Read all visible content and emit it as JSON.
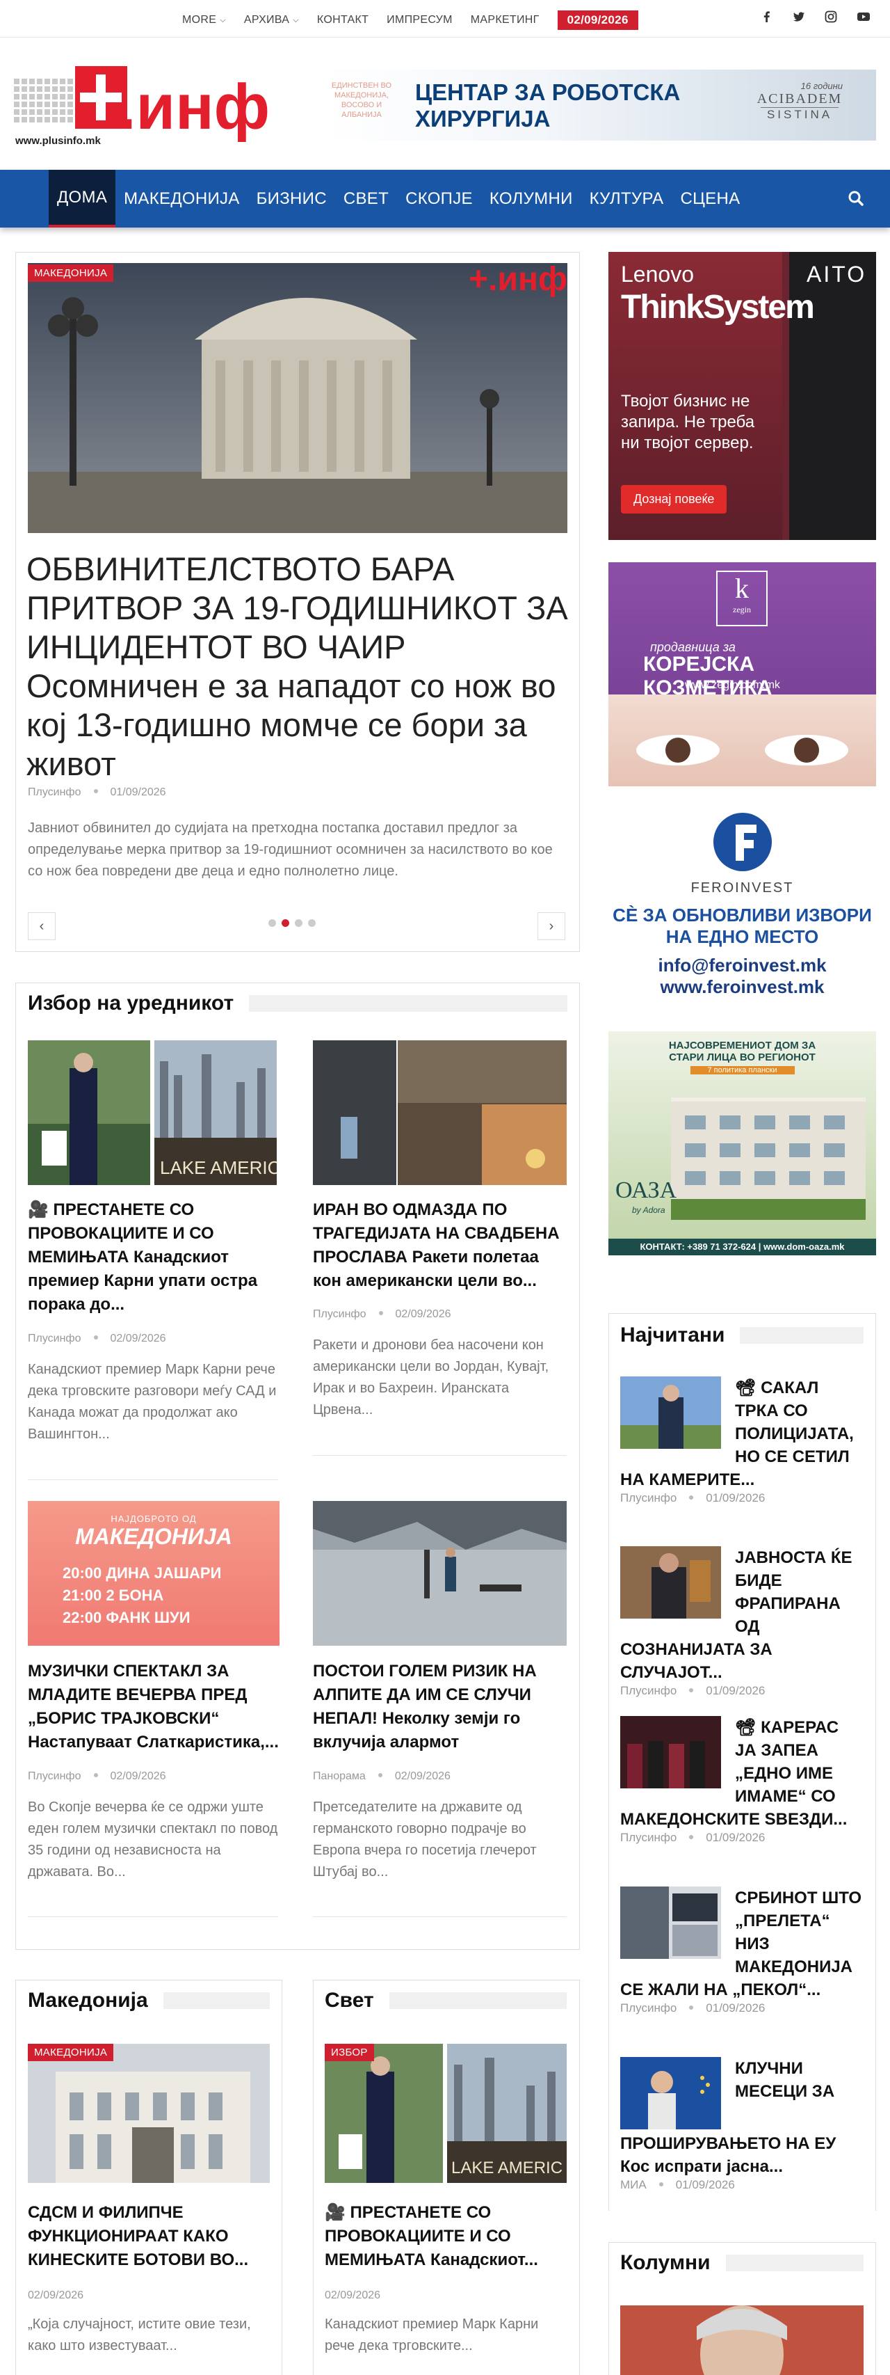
{
  "topbar": {
    "menu": [
      "MORE",
      "АРХИВА",
      "КОНТАКТ",
      "ИМПРЕСУМ",
      "МАРКЕТИНГ"
    ],
    "date": "02/09/2026"
  },
  "logo": {
    "text": "+.инф",
    "url": "www.plusinfo.mk"
  },
  "ad_top": {
    "small": "ЕДИНСТВЕН ВО МАКЕДОНИЈА, ВОСОВО И АЛБАНИЈА",
    "line1": "ЦЕНТАР ЗА РОБОТСКА",
    "line2": "ХИРУРГИЈА",
    "years": "16 години",
    "brand": "ACIBADEM",
    "brand2": "SISTINA"
  },
  "nav": {
    "items": [
      "ДОМА",
      "МАКЕДОНИЈА",
      "БИЗНИС",
      "СВЕТ",
      "СКОПЈЕ",
      "КОЛУМНИ",
      "КУЛТУРА",
      "СЦЕНА"
    ]
  },
  "featured": {
    "badge": "МАКЕДОНИЈА",
    "title": "ОБВИНИТЕЛСТВОТО БАРА ПРИТВОР ЗА 19-ГОДИШНИКОТ ЗА ИНЦИДЕНТОТ ВО ЧАИР Осомничен е за нападот со нож во кој 13-годишно момче се бори за живот",
    "author": "Плусинфо",
    "date": "01/09/2026",
    "excerpt": "Јавниот обвинител до судијата на претходна постапка доставил предлог за определување мерка притвор за 19-годишниот осомничен за насилството во кое со нож беа повредени две деца и едно полнолетно лице.",
    "prev": "‹",
    "next": "›"
  },
  "editor": {
    "title": "Избор на уредникот",
    "posts": [
      {
        "title": "🎥 ПРЕСТАНЕТЕ СО ПРОВОКАЦИИТЕ И СО МЕМИЊАТА Канадскиот премиер Карни упати остра порака до...",
        "author": "Плусинфо",
        "date": "02/09/2026",
        "excerpt": "Канадскиот премиер Марк Карни рече дека трговските разговори меѓу САД и Канада можат да продолжат ако Вашингтон..."
      },
      {
        "title": "ИРАН ВО ОДМАЗДА ПО ТРАГЕДИЈАТА НА СВАДБЕНА ПРОСЛАВА Ракети полетаа кон американски цели во...",
        "author": "Плусинфо",
        "date": "02/09/2026",
        "excerpt": "Ракети и дронови беа насочени кон американски цели во Јордан, Кувајт, Ирак и во Бахреин. Иранската Црвена..."
      },
      {
        "title": "МУЗИЧКИ СПЕКТАКЛ ЗА МЛАДИТЕ ВЕЧЕРВА ПРЕД „БОРИС ТРАЈКОВСКИ“ Настапуваат Слатка­ристика,...",
        "author": "Плусинфо",
        "date": "02/09/2026",
        "excerpt": "Во Скопје вечерва ќе се одржи уште еден голем музички спектакл по повод 35 години од независноста на државата. Во..."
      },
      {
        "title": "ПОСТОИ ГОЛЕМ РИЗИК НА АЛПИТЕ ДА ИМ СЕ СЛУЧИ НЕПАЛ! Неколку земји го вклучија алармот",
        "author": "Панорама",
        "date": "02/09/2026",
        "excerpt": "Претседателите на државите од германското говорно подрачје во Европа вчера го посетија глечерот Штубај во..."
      }
    ],
    "poster": {
      "top": "НАЈДОБРОТО ОД",
      "big": "МАКЕДОНИЈА",
      "rows": [
        "20:00  ДИНА ЈАШАРИ",
        "21:00  2 БОНА",
        "22:00  ФАНК ШУИ"
      ]
    },
    "sign": "LAKE AMERIC"
  },
  "macedonia": {
    "title": "Македонија",
    "badge": "МАКЕДОНИЈА",
    "post_title": "СДСМ И ФИЛИПЧЕ ФУНКЦИОНИРААТ КАКО КИНЕСКИТЕ БОТОВИ ВО...",
    "date": "02/09/2026",
    "excerpt": "„Која случајност, истите овие тези, како што известуваат..."
  },
  "world": {
    "title": "Свет",
    "badge": "ИЗБОР",
    "post_title": "🎥 ПРЕСТАНЕТЕ СО ПРОВОКАЦИИТЕ И СО МЕМИЊАТА Канадскиот...",
    "date": "02/09/2026",
    "excerpt": "Канадскиот премиер Марк Карни рече дека трговските..."
  },
  "ads": {
    "lenovo": {
      "brand": "Lenovo",
      "product": "ThinkSystem",
      "aito": "AITO",
      "text": "Твојот бизнис не запира. Не треба ни твојот сервер.",
      "cta": "Дознај повеќе"
    },
    "zegin": {
      "k": "k",
      "name": "zegin",
      "l1": "продавница за",
      "l2": "КОРЕЈСКА КОЗМЕТИКА",
      "url": "www.zegin.com.mk"
    },
    "feroinvest": {
      "name": "FEROINVEST",
      "l1": "СÈ ЗА ОБНОВЛИВИ ИЗВОРИ",
      "l2": "НА ЕДНО МЕСТО",
      "mail": "info@feroinvest.mk",
      "web": "www.feroinvest.mk"
    },
    "oaza": {
      "l1": "НАЈСОВРЕМЕНИОТ ДОМ ЗА",
      "l2": "СТАРИ ЛИЦА ВО РЕГИОНОТ",
      "tag": "7 политика плански",
      "name": "ОАЗА",
      "by": "by Adora",
      "contact": "КОНТАКТ: +389 71 372-624 | www.dom-oaza.mk"
    }
  },
  "popular": {
    "title": "Најчитани",
    "items": [
      {
        "title": "📽 САКАЛ ТРКА СО ПОЛИЦИЈАТА, НО СЕ СЕТИЛ НА КАМЕРИТЕ...",
        "author": "Плусинфо",
        "date": "01/09/2026"
      },
      {
        "title": "ЈАВНОСТА ЌЕ БИДЕ ФРАПИРАНА ОД СОЗНАНИЈАТА ЗА СЛУЧАЈОТ...",
        "author": "Плусинфо",
        "date": "01/09/2026"
      },
      {
        "title": "📽 КАРЕРАС ЈА ЗАПЕА „ЕДНО ИМЕ ИМАМЕ“ СО МАКЕДОНСКИТЕ ЅВЕЗДИ...",
        "author": "Плусинфо",
        "date": "01/09/2026"
      },
      {
        "title": "СРБИНОТ ШТО „ПРЕЛЕТА“ НИЗ МАКЕДОНИЈА СЕ ЖАЛИ НА „ПЕКОЛ“...",
        "author": "Плусинфо",
        "date": "01/09/2026"
      },
      {
        "title": "КЛУЧНИ МЕСЕЦИ ЗА ПРОШИРУВАЊЕТО НА ЕУ Кос испрати јасна...",
        "author": "МИА",
        "date": "01/09/2026"
      }
    ]
  },
  "columns": {
    "title": "Колумни"
  },
  "colors": {
    "red": "#d01f2e",
    "blue": "#1957a6",
    "navy": "#0c1f3d"
  }
}
